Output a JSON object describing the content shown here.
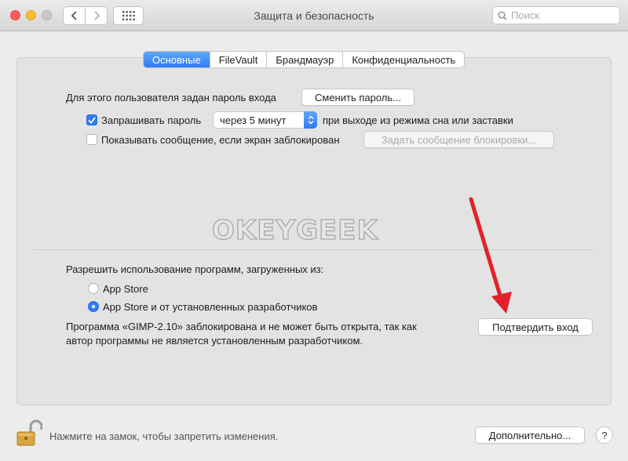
{
  "window": {
    "title": "Защита и безопасность"
  },
  "search": {
    "placeholder": "Поиск"
  },
  "tabs": [
    {
      "label": "Основные",
      "active": true
    },
    {
      "label": "FileVault",
      "active": false
    },
    {
      "label": "Брандмауэр",
      "active": false
    },
    {
      "label": "Конфиденциальность",
      "active": false
    }
  ],
  "general": {
    "password_text": "Для этого пользователя задан пароль входа",
    "change_password_label": "Сменить пароль...",
    "require_password": {
      "label": "Запрашивать пароль",
      "checked": true
    },
    "require_password_delay": "через 5 минут",
    "require_password_suffix": "при выходе из режима сна или заставки",
    "show_message": {
      "label": "Показывать сообщение, если экран заблокирован",
      "checked": false
    },
    "set_lock_message_label": "Задать сообщение блокировки..."
  },
  "watermark": "OKEYGEEK",
  "downloads": {
    "heading": "Разрешить использование программ, загруженных из:",
    "options": [
      {
        "label": "App Store",
        "selected": false
      },
      {
        "label": "App Store и от установленных разработчиков",
        "selected": true
      }
    ],
    "blocked_line1": "Программа «GIMP-2.10» заблокирована и не может быть открыта, так как",
    "blocked_line2": "автор программы не является установленным разработчиком.",
    "confirm_label": "Подтвердить вход"
  },
  "footer": {
    "lock_text": "Нажмите на замок, чтобы запретить изменения.",
    "advanced_label": "Дополнительно...",
    "help_label": "?"
  },
  "colors": {
    "accent": "#2f7cf6",
    "annotation_arrow": "#e4202a"
  }
}
